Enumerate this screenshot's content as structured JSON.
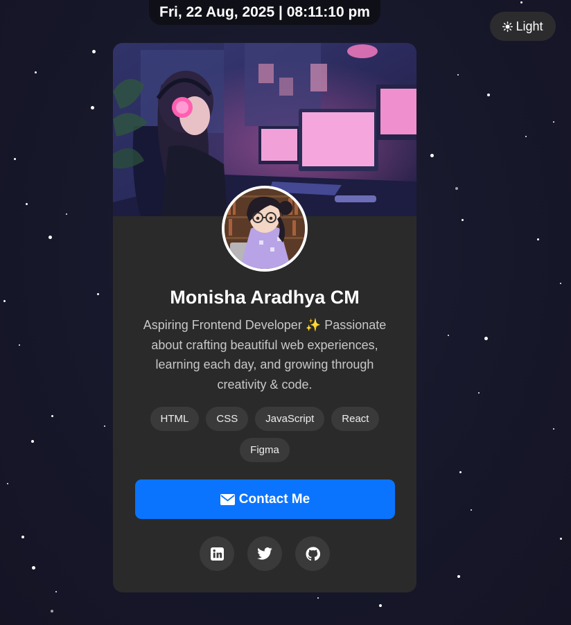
{
  "header": {
    "datetime": "Fri, 22 Aug, 2025 | 08:11:10 pm"
  },
  "theme_toggle": {
    "icon": "sun-icon",
    "label": "Light"
  },
  "profile": {
    "banner_image": "anime-coder-at-desk-illustration",
    "avatar_image": "anime-girl-with-glasses-avatar",
    "name": "Monisha Aradhya CM",
    "bio": "Aspiring Frontend Developer ✨ Passionate about crafting beautiful web experiences, learning each day, and growing through creativity & code.",
    "skills": [
      "HTML",
      "CSS",
      "JavaScript",
      "React",
      "Figma"
    ]
  },
  "contact_button": {
    "icon": "envelope-icon",
    "label": "Contact Me"
  },
  "socials": [
    {
      "name": "linkedin",
      "icon": "linkedin-icon"
    },
    {
      "name": "twitter",
      "icon": "twitter-icon"
    },
    {
      "name": "github",
      "icon": "github-icon"
    }
  ],
  "colors": {
    "background": "#17172a",
    "card": "#2a2a2a",
    "accent": "#0a74ff",
    "tag_background": "#3a3a3a"
  }
}
